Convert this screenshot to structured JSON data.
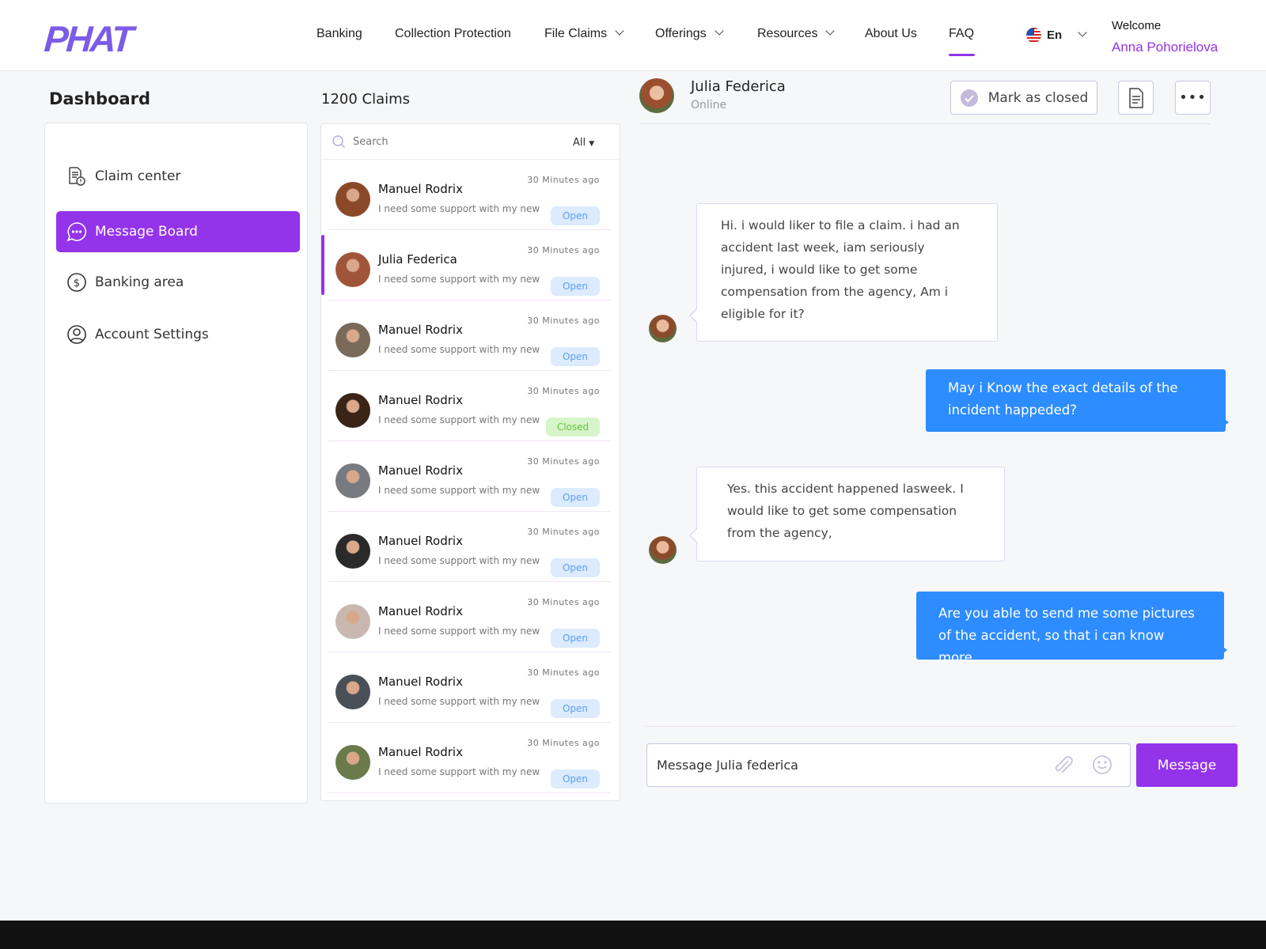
{
  "header": {
    "logo": "PHAT",
    "nav": [
      {
        "label": "Banking"
      },
      {
        "label": "Collection Protection"
      },
      {
        "label": "File Claims"
      },
      {
        "label": "Offerings"
      },
      {
        "label": "Resources"
      },
      {
        "label": "About Us"
      },
      {
        "label": "FAQ"
      }
    ],
    "language": "En",
    "welcome": "Welcome",
    "user": "Anna Pohorielova",
    "accent": "#9333ea"
  },
  "sidebar": {
    "title": "Dashboard",
    "items": [
      {
        "label": "Claim center",
        "icon": "claim-doc-icon"
      },
      {
        "label": "Message Board",
        "icon": "chat-icon",
        "active": true
      },
      {
        "label": "Banking area",
        "icon": "dollar-icon"
      },
      {
        "label": "Account Settings",
        "icon": "user-icon"
      }
    ]
  },
  "claims": {
    "count_label": "1200 Claims",
    "search_placeholder": "Search",
    "filter": "All",
    "rows": [
      {
        "name": "Manuel Rodrix",
        "time": "30 Minutes ago",
        "message": "I need some support with my new",
        "status": "Open",
        "avatar": "#8a4a2a"
      },
      {
        "name": "Julia Federica",
        "time": "30 Minutes ago",
        "message": "I need some support with my new",
        "status": "Open",
        "selected": true,
        "avatar": "#a0553a"
      },
      {
        "name": "Manuel Rodrix",
        "time": "30 Minutes ago",
        "message": "I need some support with my new",
        "status": "Open",
        "avatar": "#7a6a5a"
      },
      {
        "name": "Manuel Rodrix",
        "time": "30 Minutes ago",
        "message": "I need some support with my new",
        "status": "Closed",
        "avatar": "#3a2418"
      },
      {
        "name": "Manuel Rodrix",
        "time": "30 Minutes ago",
        "message": "I need some support with my new",
        "status": "Open",
        "avatar": "#777a80"
      },
      {
        "name": "Manuel Rodrix",
        "time": "30 Minutes ago",
        "message": "I need some support with my new",
        "status": "Open",
        "avatar": "#2a2a2a"
      },
      {
        "name": "Manuel Rodrix",
        "time": "30 Minutes ago",
        "message": "I need some support with my new",
        "status": "Open",
        "avatar": "#c8b8b0"
      },
      {
        "name": "Manuel Rodrix",
        "time": "30 Minutes ago",
        "message": "I need some support with my new",
        "status": "Open",
        "avatar": "#4a5058"
      },
      {
        "name": "Manuel Rodrix",
        "time": "30 Minutes ago",
        "message": "I need some support with my new",
        "status": "Open",
        "avatar": "#6a7a4a"
      }
    ]
  },
  "chat": {
    "contact": "Julia Federica",
    "presence": "Online",
    "mark_closed": "Mark as closed",
    "messages": [
      {
        "from": "contact",
        "text": "Hi. i would liker to file a claim. i had an accident last week, iam seriously injured, i would like to get some compensation from the agency, Am i eligible for it?"
      },
      {
        "from": "me",
        "text": "May i Know the exact details of the incident happeded?"
      },
      {
        "from": "contact",
        "text": "Yes. this accident happened lasweek. I would like to get some compensation from the agency,"
      },
      {
        "from": "me",
        "text": "Are you able to send me some pictures of the accident, so that i can know more"
      }
    ],
    "input_value": "Message Julia federica",
    "send_label": "Message",
    "bubble_color": "#2d8cff"
  }
}
